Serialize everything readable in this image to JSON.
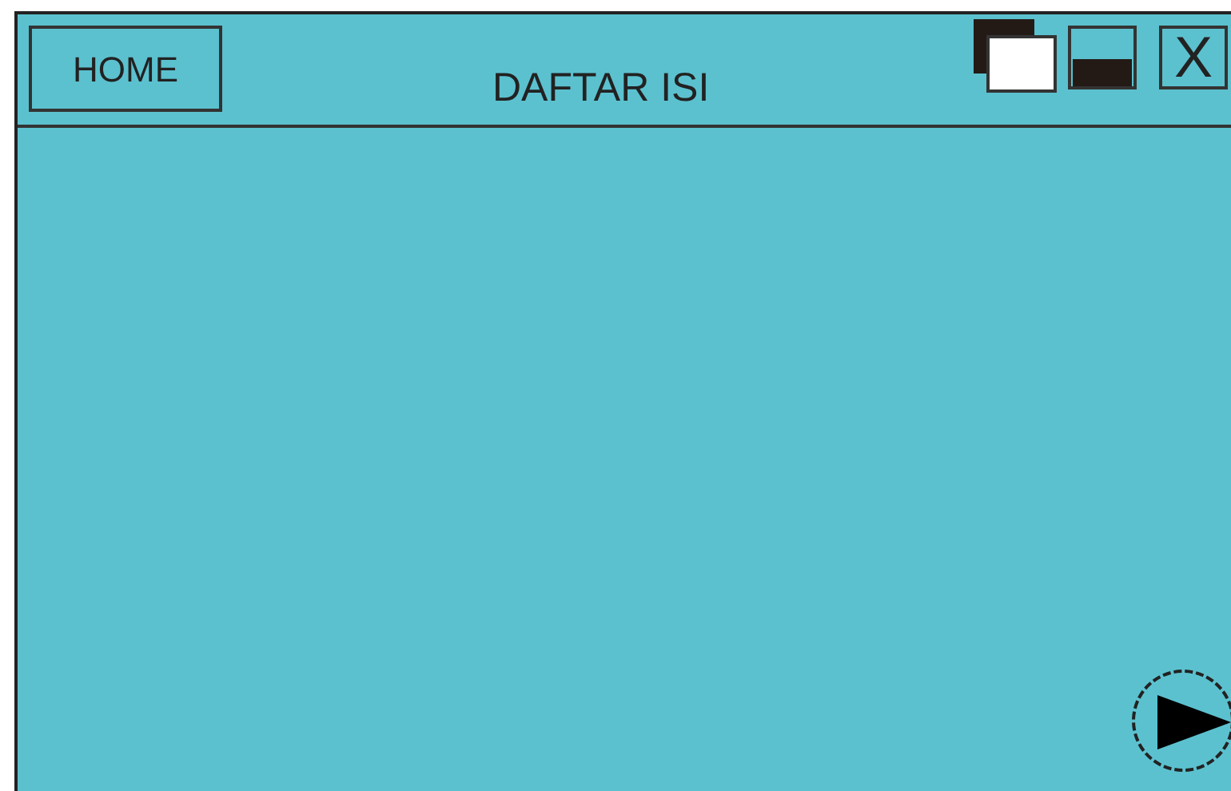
{
  "header": {
    "home_button": "HOME",
    "title": "DAFTAR ISI",
    "close_button": "X"
  }
}
